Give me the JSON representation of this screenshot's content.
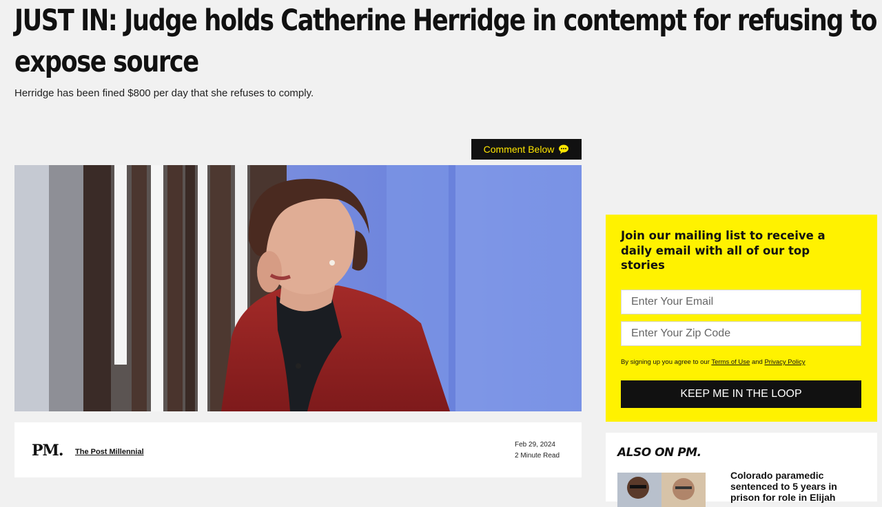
{
  "article": {
    "headline": "JUST IN: Judge holds Catherine Herridge in contempt for refusing to expose source",
    "subhead": "Herridge has been fined $800 per day that she refuses to comply.",
    "comment_button": "Comment Below",
    "comment_icon": "speech-bubble-icon",
    "publisher_logo": "PM.",
    "publisher_name": "The Post Millennial",
    "date": "Feb 29, 2024",
    "read_time": "2 Minute Read"
  },
  "signup": {
    "title": "Join our mailing list to receive a daily email with all of our top stories",
    "email_placeholder": "Enter Your Email",
    "zip_placeholder": "Enter Your Zip Code",
    "terms_prefix": "By signing up you agree to our",
    "terms_link": "Terms of Use",
    "terms_and": "and",
    "privacy_link": "Privacy Policy",
    "button": "KEEP ME IN THE LOOP"
  },
  "also_on": {
    "title": "ALSO ON PM.",
    "items": [
      {
        "headline": "Colorado paramedic sentenced to 5 years in prison for role in Elijah"
      }
    ]
  },
  "colors": {
    "accent_yellow": "#fff200",
    "comment_text": "#ffe600",
    "dark": "#111111",
    "page_bg": "#f1f1f1"
  }
}
